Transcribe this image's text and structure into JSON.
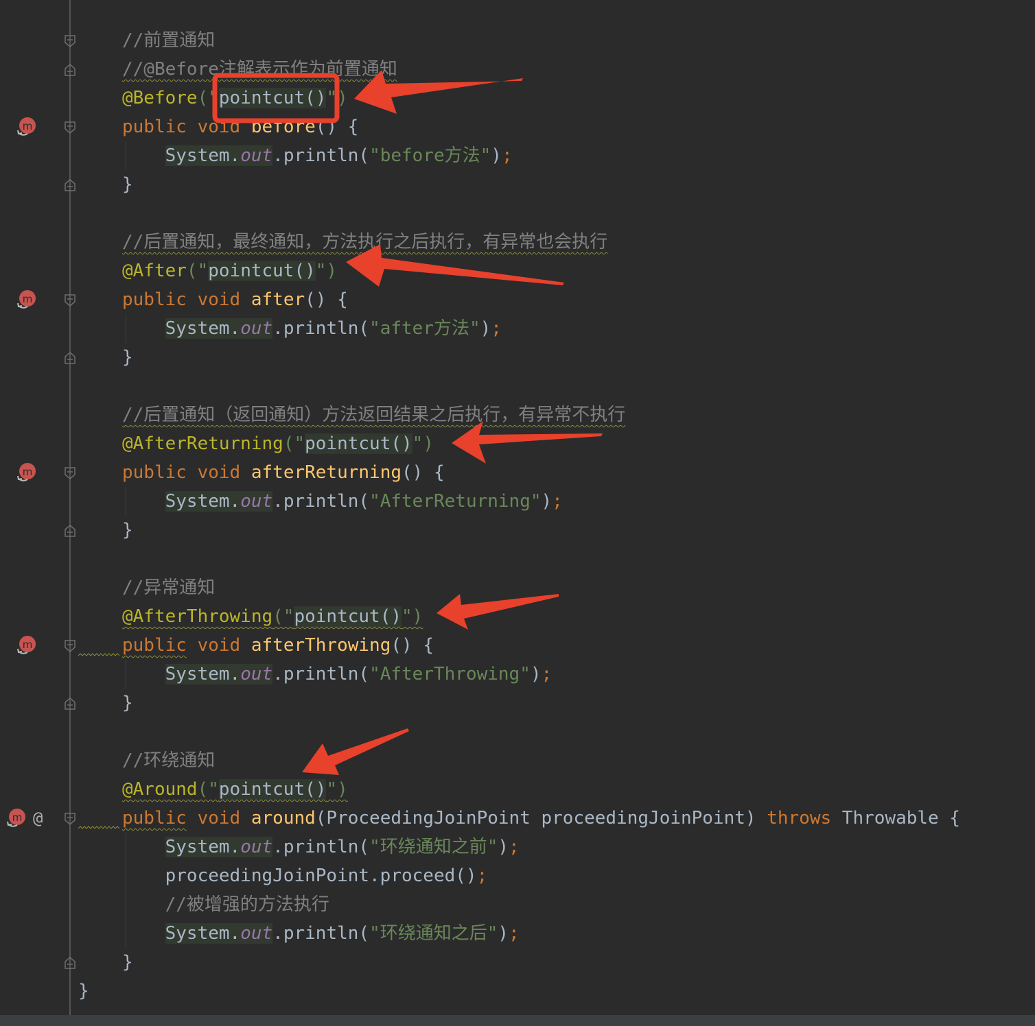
{
  "editor": {
    "code_lines": [
      {
        "id": "l1",
        "tokens": [
          {
            "t": "//前置通知",
            "c": "cm"
          }
        ]
      },
      {
        "id": "l2",
        "tokens": [
          {
            "t": "//@Before注解表示作为前置通知",
            "c": "cm wavy"
          }
        ]
      },
      {
        "id": "l3",
        "tokens": [
          {
            "t": "@Before",
            "c": "ann"
          },
          {
            "t": "(\"",
            "c": "str"
          },
          {
            "t": "pointcut()",
            "c": "hl"
          },
          {
            "t": "\")",
            "c": "str"
          }
        ]
      },
      {
        "id": "l4",
        "tokens": [
          {
            "t": "public",
            "c": "k"
          },
          {
            "t": " "
          },
          {
            "t": "void",
            "c": "k"
          },
          {
            "t": " "
          },
          {
            "t": "before",
            "c": "fn"
          },
          {
            "t": "() {"
          }
        ]
      },
      {
        "id": "l5",
        "tokens": [
          {
            "t": "    "
          },
          {
            "t": "System",
            "c": "hl"
          },
          {
            "t": ".",
            "c": "hl"
          },
          {
            "t": "out",
            "c": "fld hl"
          },
          {
            "t": ".println("
          },
          {
            "t": "\"before方法\"",
            "c": "str"
          },
          {
            "t": ")"
          },
          {
            "t": ";",
            "c": "semi"
          }
        ]
      },
      {
        "id": "l6",
        "tokens": [
          {
            "t": "}"
          }
        ]
      },
      {
        "id": "l7",
        "tokens": [
          {
            "t": "//后置通知，最终通知，方法执行之后执行，有异常也会执行",
            "c": "cm wavy"
          }
        ]
      },
      {
        "id": "l8",
        "tokens": [
          {
            "t": "@After",
            "c": "ann"
          },
          {
            "t": "(\"",
            "c": "str"
          },
          {
            "t": "pointcut()",
            "c": "hl"
          },
          {
            "t": "\")",
            "c": "str"
          }
        ]
      },
      {
        "id": "l9",
        "tokens": [
          {
            "t": "public",
            "c": "k"
          },
          {
            "t": " "
          },
          {
            "t": "void",
            "c": "k"
          },
          {
            "t": " "
          },
          {
            "t": "after",
            "c": "fn"
          },
          {
            "t": "() {"
          }
        ]
      },
      {
        "id": "l10",
        "tokens": [
          {
            "t": "    "
          },
          {
            "t": "System",
            "c": "hl"
          },
          {
            "t": ".",
            "c": "hl"
          },
          {
            "t": "out",
            "c": "fld hl"
          },
          {
            "t": ".println("
          },
          {
            "t": "\"after方法\"",
            "c": "str"
          },
          {
            "t": ")"
          },
          {
            "t": ";",
            "c": "semi"
          }
        ]
      },
      {
        "id": "l11",
        "tokens": [
          {
            "t": "}"
          }
        ]
      },
      {
        "id": "l12",
        "tokens": [
          {
            "t": "//后置通知（返回通知）方法返回结果之后执行，有异常不执行",
            "c": "cm wavy"
          }
        ]
      },
      {
        "id": "l13",
        "tokens": [
          {
            "t": "@AfterReturning",
            "c": "ann"
          },
          {
            "t": "(\"",
            "c": "str"
          },
          {
            "t": "pointcut()",
            "c": "hl"
          },
          {
            "t": "\")",
            "c": "str"
          }
        ]
      },
      {
        "id": "l14",
        "tokens": [
          {
            "t": "public",
            "c": "k"
          },
          {
            "t": " "
          },
          {
            "t": "void",
            "c": "k"
          },
          {
            "t": " "
          },
          {
            "t": "afterReturning",
            "c": "fn"
          },
          {
            "t": "() {"
          }
        ]
      },
      {
        "id": "l15",
        "tokens": [
          {
            "t": "    "
          },
          {
            "t": "System",
            "c": "hl"
          },
          {
            "t": ".",
            "c": "hl"
          },
          {
            "t": "out",
            "c": "fld hl"
          },
          {
            "t": ".println("
          },
          {
            "t": "\"AfterReturning\"",
            "c": "str"
          },
          {
            "t": ")"
          },
          {
            "t": ";",
            "c": "semi"
          }
        ]
      },
      {
        "id": "l16",
        "tokens": [
          {
            "t": "}"
          }
        ]
      },
      {
        "id": "l17",
        "tokens": [
          {
            "t": "//异常通知",
            "c": "cm"
          }
        ]
      },
      {
        "id": "l18",
        "tokens": [
          {
            "t": "@AfterThrowing",
            "c": "ann wavy"
          },
          {
            "t": "(\"",
            "c": "str wavy"
          },
          {
            "t": "pointcut()",
            "c": "hl wavy"
          },
          {
            "t": "\")",
            "c": "str wavy"
          }
        ]
      },
      {
        "id": "l19",
        "tokens": [
          {
            "t": "public",
            "c": "k wavy"
          },
          {
            "t": " "
          },
          {
            "t": "void",
            "c": "k"
          },
          {
            "t": " "
          },
          {
            "t": "afterThrowing",
            "c": "fn"
          },
          {
            "t": "() {"
          }
        ]
      },
      {
        "id": "l20",
        "tokens": [
          {
            "t": "    "
          },
          {
            "t": "System",
            "c": "hl"
          },
          {
            "t": ".",
            "c": "hl"
          },
          {
            "t": "out",
            "c": "fld hl"
          },
          {
            "t": ".println("
          },
          {
            "t": "\"AfterThrowing\"",
            "c": "str"
          },
          {
            "t": ")"
          },
          {
            "t": ";",
            "c": "semi"
          }
        ]
      },
      {
        "id": "l21",
        "tokens": [
          {
            "t": "}"
          }
        ]
      },
      {
        "id": "l22",
        "tokens": [
          {
            "t": "//环绕通知",
            "c": "cm"
          }
        ]
      },
      {
        "id": "l23",
        "tokens": [
          {
            "t": "@Around",
            "c": "ann wavy"
          },
          {
            "t": "(\"",
            "c": "str wavy"
          },
          {
            "t": "pointcut()",
            "c": "hl wavy"
          },
          {
            "t": "\")",
            "c": "str wavy"
          }
        ]
      },
      {
        "id": "l24",
        "tokens": [
          {
            "t": "public",
            "c": "k wavy"
          },
          {
            "t": " "
          },
          {
            "t": "void",
            "c": "k"
          },
          {
            "t": " "
          },
          {
            "t": "around",
            "c": "fn"
          },
          {
            "t": "(ProceedingJoinPoint proceedingJoinPoint) "
          },
          {
            "t": "throws",
            "c": "k"
          },
          {
            "t": " Throwable {"
          }
        ]
      },
      {
        "id": "l25",
        "tokens": [
          {
            "t": "    "
          },
          {
            "t": "System",
            "c": "hl"
          },
          {
            "t": ".",
            "c": "hl"
          },
          {
            "t": "out",
            "c": "fld hl"
          },
          {
            "t": ".println("
          },
          {
            "t": "\"环绕通知之前\"",
            "c": "str"
          },
          {
            "t": ")"
          },
          {
            "t": ";",
            "c": "semi"
          }
        ]
      },
      {
        "id": "l26",
        "tokens": [
          {
            "t": "    proceedingJoinPoint.proceed()"
          },
          {
            "t": ";",
            "c": "semi"
          }
        ]
      },
      {
        "id": "l27",
        "tokens": [
          {
            "t": "    "
          },
          {
            "t": "//被增强的方法执行",
            "c": "cm"
          }
        ]
      },
      {
        "id": "l28",
        "tokens": [
          {
            "t": "    "
          },
          {
            "t": "System",
            "c": "hl"
          },
          {
            "t": ".",
            "c": "hl"
          },
          {
            "t": "out",
            "c": "fld hl"
          },
          {
            "t": ".println("
          },
          {
            "t": "\"环绕通知之后\"",
            "c": "str"
          },
          {
            "t": ")"
          },
          {
            "t": ";",
            "c": "semi"
          }
        ]
      },
      {
        "id": "l29",
        "tokens": [
          {
            "t": "}"
          }
        ]
      },
      {
        "id": "l30",
        "tokens": [
          {
            "t": "}"
          }
        ]
      }
    ],
    "gutter": {
      "override_icon": "method-override-icon",
      "at_icon": "@",
      "fold_icon": "fold-marker-icon"
    }
  },
  "theme": {
    "background": "#2b2b2b",
    "keyword": "#cc7832",
    "annotation": "#bbb529",
    "method": "#ffc66d",
    "string": "#6a8759",
    "comment": "#808080",
    "field": "#9876aa",
    "arrow": "#e8412c"
  }
}
